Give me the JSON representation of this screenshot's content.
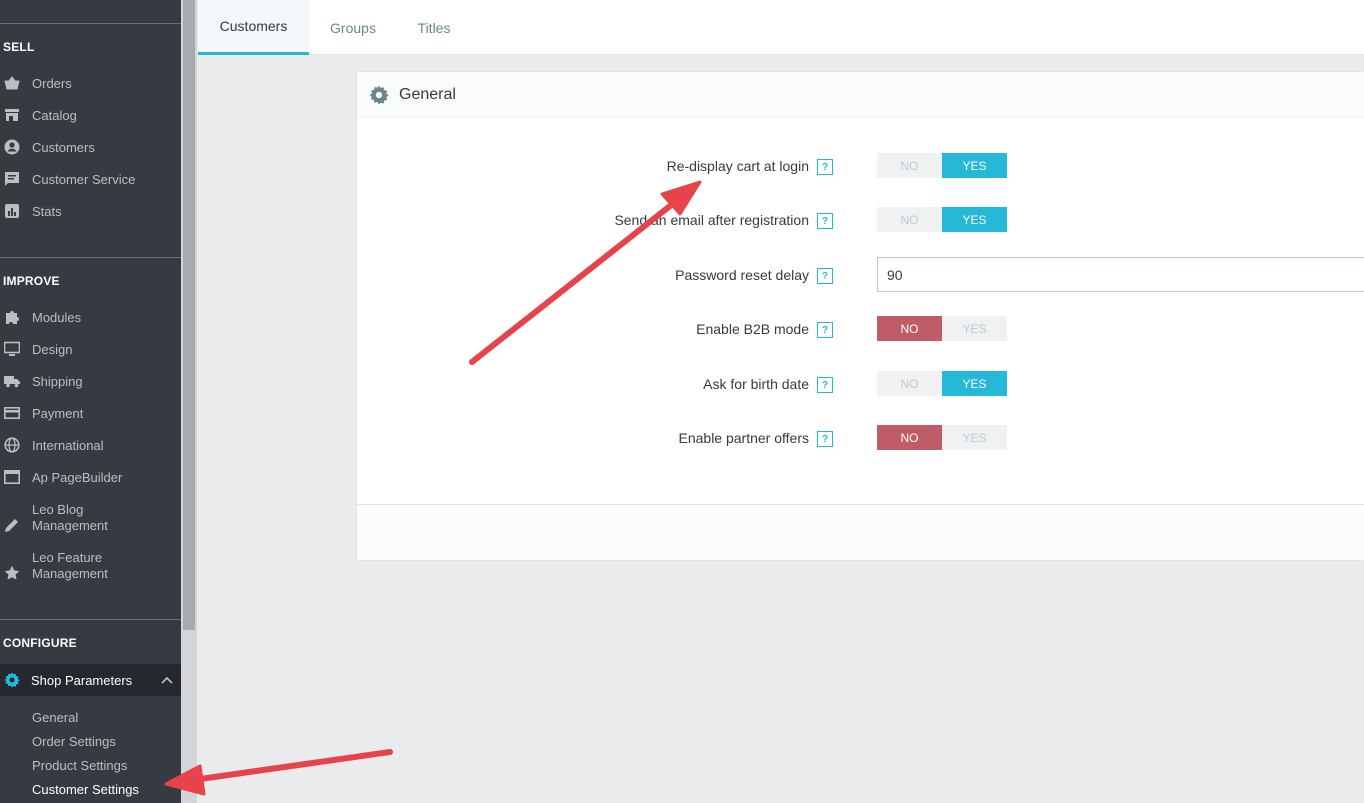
{
  "sidebar": {
    "sell": {
      "title": "SELL",
      "items": [
        {
          "label": "Orders",
          "icon": "basket-icon"
        },
        {
          "label": "Catalog",
          "icon": "store-icon"
        },
        {
          "label": "Customers",
          "icon": "account-circle-icon"
        },
        {
          "label": "Customer Service",
          "icon": "chat-icon"
        },
        {
          "label": "Stats",
          "icon": "chart-icon"
        }
      ]
    },
    "improve": {
      "title": "IMPROVE",
      "items": [
        {
          "label": "Modules",
          "icon": "puzzle-icon"
        },
        {
          "label": "Design",
          "icon": "monitor-icon"
        },
        {
          "label": "Shipping",
          "icon": "truck-icon"
        },
        {
          "label": "Payment",
          "icon": "credit-card-icon"
        },
        {
          "label": "International",
          "icon": "globe-icon"
        },
        {
          "label": "Ap PageBuilder",
          "icon": "window-icon"
        },
        {
          "label": "Leo Blog Management",
          "icon": "pencil-icon"
        },
        {
          "label": "Leo Feature Management",
          "icon": "star-icon"
        }
      ]
    },
    "configure": {
      "title": "CONFIGURE",
      "active": {
        "label": "Shop Parameters",
        "icon": "gear-icon"
      },
      "subitems": [
        {
          "label": "General"
        },
        {
          "label": "Order Settings"
        },
        {
          "label": "Product Settings"
        },
        {
          "label": "Customer Settings"
        }
      ]
    }
  },
  "tabs": [
    {
      "label": "Customers",
      "active": true
    },
    {
      "label": "Groups",
      "active": false
    },
    {
      "label": "Titles",
      "active": false
    }
  ],
  "panel": {
    "title": "General",
    "help_glyph": "?",
    "fields": [
      {
        "label": "Re-display cart at login",
        "type": "switch",
        "value": "YES",
        "no": "NO",
        "yes": "YES"
      },
      {
        "label": "Send an email after registration",
        "type": "switch",
        "value": "YES",
        "no": "NO",
        "yes": "YES"
      },
      {
        "label": "Password reset delay",
        "type": "text",
        "value": "90"
      },
      {
        "label": "Enable B2B mode",
        "type": "switch",
        "value": "NO",
        "no": "NO",
        "yes": "YES"
      },
      {
        "label": "Ask for birth date",
        "type": "switch",
        "value": "YES",
        "no": "NO",
        "yes": "YES"
      },
      {
        "label": "Enable partner offers",
        "type": "switch",
        "value": "NO",
        "no": "NO",
        "yes": "YES"
      }
    ]
  },
  "colors": {
    "sidebar_bg": "#363a41",
    "accent": "#25b9d7",
    "danger": "#c05c67",
    "annotation_arrow": "#e8424a"
  }
}
